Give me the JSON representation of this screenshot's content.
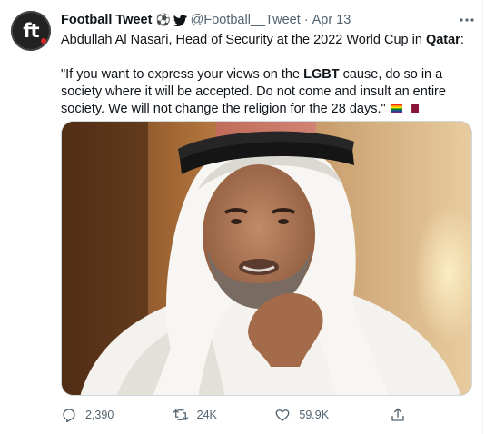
{
  "tweet": {
    "author_name": "Football Tweet",
    "name_emojis": "⚽",
    "handle": "@Football__Tweet",
    "separator": "·",
    "date": "Apr 13",
    "avatar_text": "ft",
    "line1_pre": "Abdullah Al Nasari, Head of Security at the 2022 World Cup in ",
    "line1_bold": "Qatar",
    "line1_post": ":",
    "quote_pre": "\"If you want to express your views on the ",
    "quote_bold": "LGBT",
    "quote_post": " cause, do so in a society where it will be accepted. Do not come and insult an entire society. We will not change the religion for the 28 days.\"",
    "flags": [
      "rainbow-flag",
      "qatar-flag"
    ]
  },
  "actions": {
    "reply_count": "2,390",
    "retweet_count": "24K",
    "like_count": "59.9K"
  },
  "colors": {
    "text_primary": "#0f1419",
    "text_secondary": "#536471",
    "border": "#cfd9de",
    "qatar_maroon": "#8a1538"
  }
}
